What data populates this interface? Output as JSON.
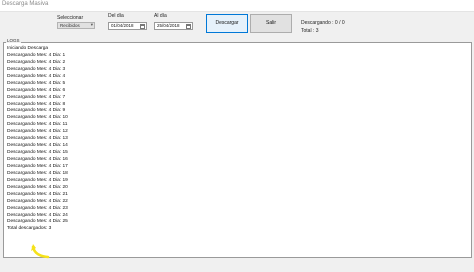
{
  "window": {
    "title": "Descarga Masiva"
  },
  "form": {
    "seleccionar_label": "Seleccionar",
    "seleccionar_value": "Recibidos",
    "del_dia_label": "Del día",
    "del_dia_value": "01/04/2018",
    "al_dia_label": "Al día",
    "al_dia_value": "25/04/2018",
    "descargar_label": "Descargar",
    "salir_label": "Salir",
    "descargando_status": "Descargando : 0 / 0",
    "total_status": "Total : 3"
  },
  "logs": {
    "group_label": "LOGS",
    "lines": [
      "Iniciando Descarga",
      "Descargando Mes: 4 Dia: 1",
      "Descargando Mes: 4 Dia: 2",
      "Descargando Mes: 4 Dia: 3",
      "Descargando Mes: 4 Dia: 4",
      "Descargando Mes: 4 Dia: 5",
      "Descargando Mes: 4 Dia: 6",
      "Descargando Mes: 4 Dia: 7",
      "Descargando Mes: 4 Dia: 8",
      "Descargando Mes: 4 Dia: 9",
      "Descargando Mes: 4 Dia: 10",
      "Descargando Mes: 4 Dia: 11",
      "Descargando Mes: 4 Dia: 12",
      "Descargando Mes: 4 Dia: 13",
      "Descargando Mes: 4 Dia: 14",
      "Descargando Mes: 4 Dia: 15",
      "Descargando Mes: 4 Dia: 16",
      "Descargando Mes: 4 Dia: 17",
      "Descargando Mes: 4 Dia: 18",
      "Descargando Mes: 4 Dia: 19",
      "Descargando Mes: 4 Dia: 20",
      "Descargando Mes: 4 Dia: 21",
      "Descargando Mes: 4 Dia: 22",
      "Descargando Mes: 4 Dia: 23",
      "Descargando Mes: 4 Dia: 24",
      "Descargando Mes: 4 Dia: 25",
      "Total descargados: 3"
    ]
  },
  "annotation": {
    "arrow_color": "#f5e21b"
  }
}
